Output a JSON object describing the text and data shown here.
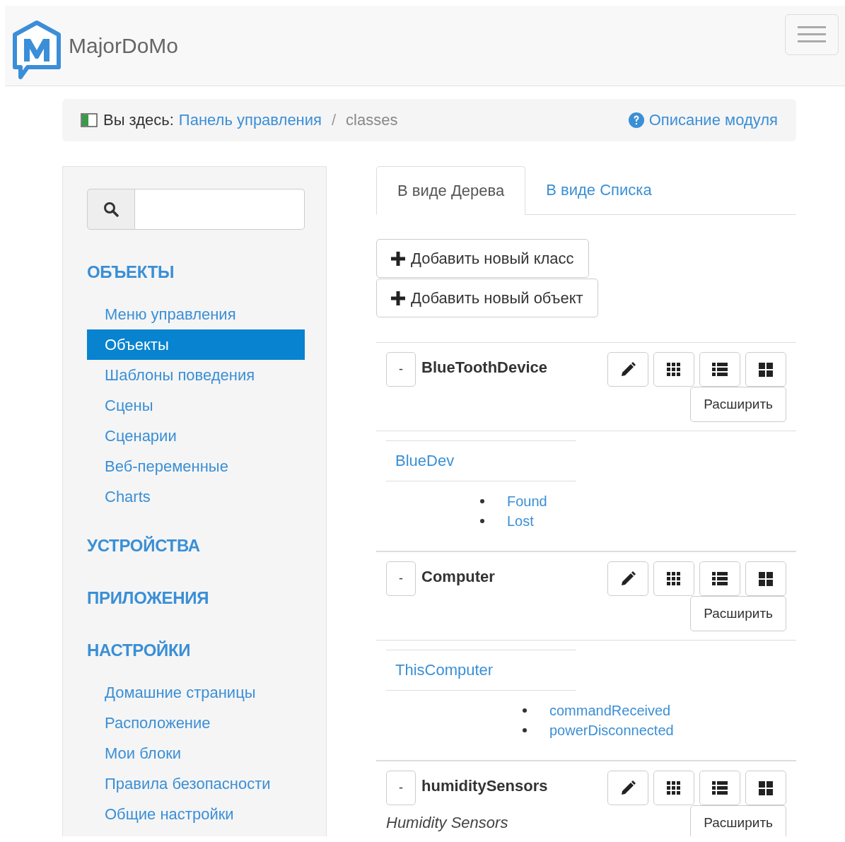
{
  "header": {
    "brand": "MajorDoMo"
  },
  "breadcrumb": {
    "label": "Вы здесь:",
    "link": "Панель управления",
    "separator": "/",
    "current": "classes",
    "help": "Описание модуля"
  },
  "sidebar": {
    "sections": [
      {
        "title": "ОБЪЕКТЫ",
        "items": [
          {
            "label": "Меню управления",
            "selected": false
          },
          {
            "label": "Объекты",
            "selected": true
          },
          {
            "label": "Шаблоны поведения",
            "selected": false
          },
          {
            "label": "Сцены",
            "selected": false
          },
          {
            "label": "Сценарии",
            "selected": false
          },
          {
            "label": "Веб-переменные",
            "selected": false
          },
          {
            "label": "Charts",
            "selected": false
          }
        ]
      },
      {
        "title": "УСТРОЙСТВА"
      },
      {
        "title": "ПРИЛОЖЕНИЯ"
      },
      {
        "title": "НАСТРОЙКИ",
        "items": [
          {
            "label": "Домашние страницы",
            "selected": false
          },
          {
            "label": "Расположение",
            "selected": false
          },
          {
            "label": "Мои блоки",
            "selected": false
          },
          {
            "label": "Правила безопасности",
            "selected": false
          },
          {
            "label": "Общие настройки",
            "selected": false
          }
        ]
      }
    ]
  },
  "tabs": [
    {
      "label": "В виде Дерева",
      "selected": true
    },
    {
      "label": "В виде Списка",
      "selected": false
    }
  ],
  "actions": [
    "Добавить новый класс",
    "Добавить новый объект"
  ],
  "classes": [
    {
      "name": "BlueToothDevice",
      "collapse": "-",
      "expand": "Расширить",
      "objects": [
        {
          "name": "BlueDev",
          "methods": [
            "Found",
            "Lost"
          ]
        }
      ]
    },
    {
      "name": "Computer",
      "collapse": "-",
      "expand": "Расширить",
      "objects": [
        {
          "name": "ThisComputer",
          "methods": [
            "commandReceived",
            "powerDisconnected"
          ]
        }
      ]
    },
    {
      "name": "humiditySensors",
      "description": "Humidity Sensors",
      "collapse": "-",
      "expand": "Расширить"
    }
  ]
}
